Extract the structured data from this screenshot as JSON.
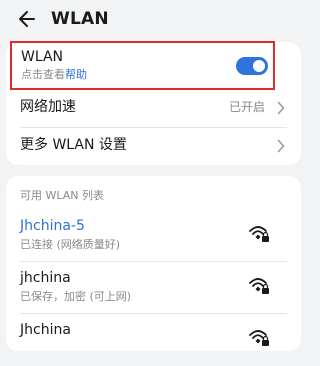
{
  "header": {
    "title": "WLAN"
  },
  "wlan": {
    "label": "WLAN",
    "hint_prefix": "点击查看",
    "hint_link": "帮助",
    "enabled": true,
    "accent_color": "#2f73dc",
    "highlight_color": "#e02b2b"
  },
  "settings": {
    "network_boost_label": "网络加速",
    "network_boost_value": "已开启",
    "more_settings_label": "更多 WLAN 设置"
  },
  "networks": {
    "section_title": "可用 WLAN 列表",
    "items": [
      {
        "name": "Jhchina-5",
        "status": "已连接 (网络质量好)",
        "connected": true,
        "icon": "wifi-lock-icon"
      },
      {
        "name": "jhchina",
        "status": "已保存，加密 (可上网)",
        "connected": false,
        "icon": "wifi-lock-icon"
      },
      {
        "name": "Jhchina",
        "status": "",
        "connected": false,
        "icon": "wifi-lock-icon"
      }
    ]
  }
}
